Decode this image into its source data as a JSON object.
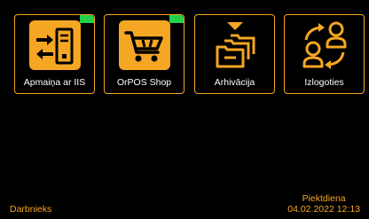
{
  "tiles": [
    {
      "label": "Apmaiņa ar IIS",
      "icon": "server-exchange-icon",
      "status": "online"
    },
    {
      "label": "OrPOS Shop",
      "icon": "shopping-cart-icon",
      "status": "online"
    },
    {
      "label": "Arhivācija",
      "icon": "archive-folders-icon"
    },
    {
      "label": "Izlogoties",
      "icon": "switch-user-icon"
    }
  ],
  "footer": {
    "role": "Darbnieks",
    "weekday": "Piektdiena",
    "datetime": "04.02.2022 12:13"
  },
  "colors": {
    "accent": "#f5a623",
    "background": "#000000",
    "status_online": "#22d14a",
    "label_text": "#ffffff"
  }
}
